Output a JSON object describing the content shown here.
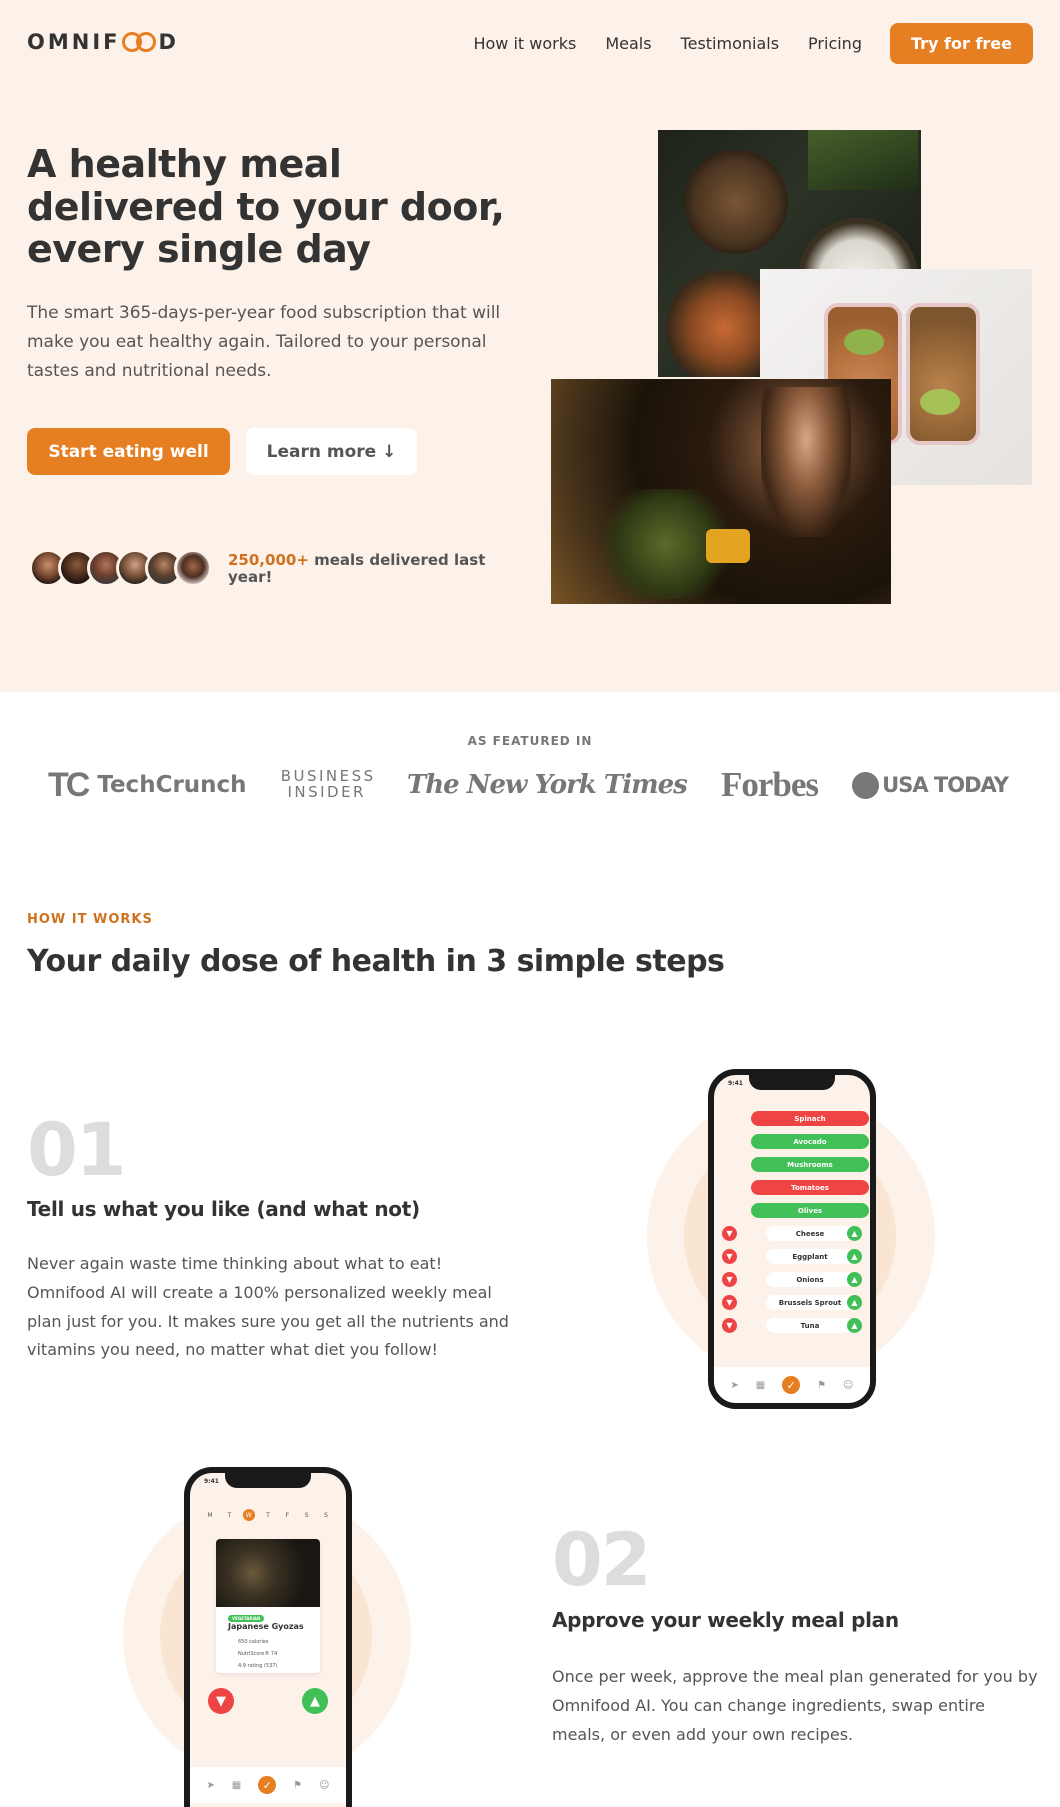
{
  "header": {
    "logo": "OMNIFOOD",
    "nav": [
      "How it works",
      "Meals",
      "Testimonials",
      "Pricing"
    ],
    "cta": "Try for free"
  },
  "hero": {
    "title": "A healthy meal delivered to your door, every single day",
    "description": "The smart 365-days-per-year food subscription that will make you eat healthy again. Tailored to your personal tastes and nutritional needs.",
    "primary_button": "Start eating well",
    "secondary_button": "Learn more ↓",
    "delivered_count": "250,000+",
    "delivered_text": " meals delivered last year!"
  },
  "featured": {
    "label": "AS FEATURED IN",
    "logos": [
      "TechCrunch",
      "BUSINESS INSIDER",
      "The New York Times",
      "Forbes",
      "USA TODAY"
    ]
  },
  "how": {
    "subheading": "HOW IT WORKS",
    "title": "Your daily dose of health in 3 simple steps",
    "steps": [
      {
        "number": "01",
        "title": "Tell us what you like (and what not)",
        "description": "Never again waste time thinking about what to eat! Omnifood AI will create a 100% personalized weekly meal plan just for you. It makes sure you get all the nutrients and vitamins you need, no matter what diet you follow!"
      },
      {
        "number": "02",
        "title": "Approve your weekly meal plan",
        "description": "Once per week, approve the meal plan generated for you by Omnifood AI. You can change ingredients, swap entire meals, or even add your own recipes."
      }
    ]
  },
  "phone1": {
    "time": "9:41",
    "pills": [
      {
        "label": "Spinach",
        "color": "red"
      },
      {
        "label": "Avocado",
        "color": "green"
      },
      {
        "label": "Mushrooms",
        "color": "green"
      },
      {
        "label": "Tomatoes",
        "color": "red"
      },
      {
        "label": "Olives",
        "color": "green"
      }
    ],
    "choices": [
      "Cheese",
      "Eggplant",
      "Onions",
      "Brussels Sprout",
      "Tuna"
    ]
  },
  "phone2": {
    "time": "9:41",
    "days": [
      "M",
      "T",
      "W",
      "T",
      "F",
      "S",
      "S"
    ],
    "tag": "VEGETARIAN",
    "meal_name": "Japanese Gyozas",
    "calories": "650 calories",
    "nutriscore": "NutriScore® 74",
    "rating": "4.9 rating (537)"
  },
  "colors": {
    "accent": "#e67e22",
    "accent_dark": "#cf711f",
    "hero_bg": "#fdf2e9",
    "green": "#40c057",
    "red": "#ef4444"
  }
}
